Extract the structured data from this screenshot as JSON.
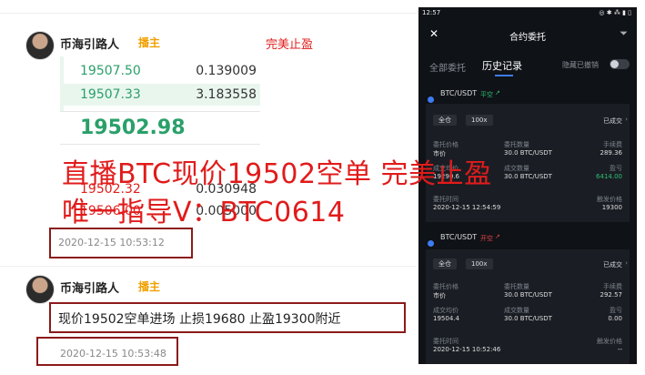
{
  "post1": {
    "username": "币海引路人",
    "role_badge": "播主",
    "red_label": "完美止盈",
    "timestamp": "2020-12-15 10:53:12"
  },
  "orderbook": {
    "rows": [
      {
        "price": "19507.50",
        "qty": "0.139009"
      },
      {
        "price": "19507.33",
        "qty": "3.183558"
      }
    ],
    "last_price": "19502.98",
    "partial_rows": [
      {
        "price": "19502.32",
        "qty": "0.030948"
      },
      {
        "price": "19506.00",
        "qty": "0.005000"
      }
    ]
  },
  "overlay": {
    "line1": "直播BTC现价19502空单 完美止盈",
    "line2": "唯一指导V：BTC0614"
  },
  "post2": {
    "username": "币海引路人",
    "role_badge": "播主",
    "message": "现价19502空单进场 止损19680 止盈19300附近",
    "timestamp": "2020-12-15 10:53:48"
  },
  "phone": {
    "status_time": "12:57",
    "status_right": "◎ ✱ ⁂ ▮ ▯",
    "title": "合约委托",
    "tabs": [
      "全部委托",
      "历史记录"
    ],
    "hide_cancelled_label": "隐藏已撤销",
    "orders": [
      {
        "pair": "BTC/USDT",
        "tag": "平空",
        "tag_color": "#2fbf71",
        "pill_mode": "全仓",
        "pill_leverage": "100x",
        "status": "已成交",
        "fields": [
          {
            "label": "委托价格",
            "value": "市价"
          },
          {
            "label": "委托数量",
            "value": "30.0 BTC/USDT"
          },
          {
            "label": "手续费",
            "value": "289.36"
          },
          {
            "label": "成交均价",
            "value": "19290.6"
          },
          {
            "label": "成交数量",
            "value": "30.0 BTC/USDT"
          },
          {
            "label": "盈亏",
            "value": "6414.00"
          },
          {
            "label": "委托时间",
            "value": "2020-12-15 12:54:59"
          },
          {
            "label": "触发价格",
            "value": "19300"
          }
        ]
      },
      {
        "pair": "BTC/USDT",
        "tag": "开空",
        "tag_color": "#e3454b",
        "pill_mode": "全仓",
        "pill_leverage": "100x",
        "status": "已成交",
        "fields": [
          {
            "label": "委托价格",
            "value": "市价"
          },
          {
            "label": "委托数量",
            "value": "30.0 BTC/USDT"
          },
          {
            "label": "手续费",
            "value": "292.57"
          },
          {
            "label": "成交均价",
            "value": "19504.4"
          },
          {
            "label": "成交数量",
            "value": "30.0 BTC/USDT"
          },
          {
            "label": "盈亏",
            "value": "0.00"
          },
          {
            "label": "委托时间",
            "value": "2020-12-15 10:52:46"
          },
          {
            "label": "触发价格",
            "value": "--"
          }
        ]
      }
    ]
  }
}
